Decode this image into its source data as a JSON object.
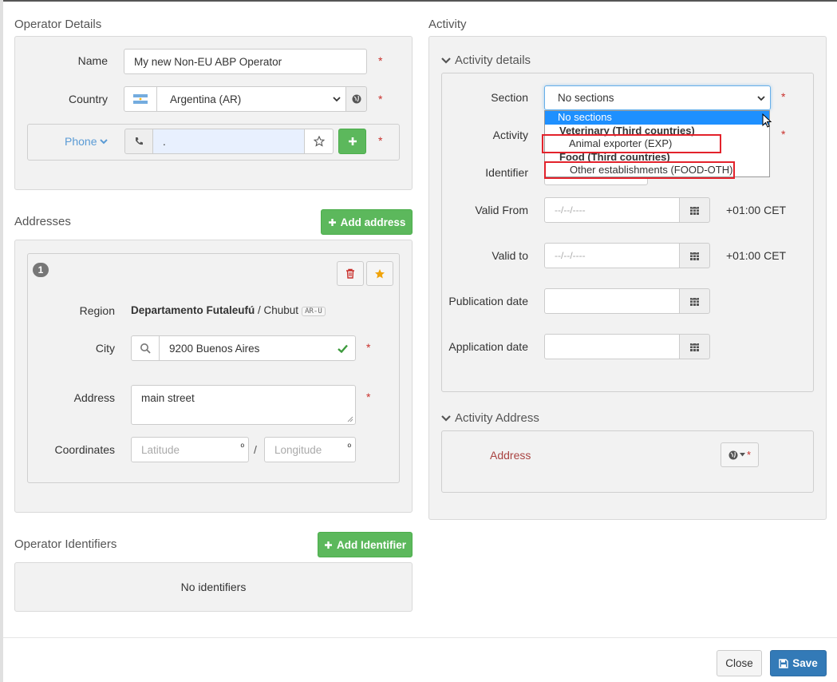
{
  "operator_details": {
    "title": "Operator Details",
    "name_label": "Name",
    "name_value": "My new Non-EU ABP Operator",
    "country_label": "Country",
    "country_value": "Argentina (AR)",
    "phone_label": "Phone",
    "phone_value": ".",
    "required_mark": "*"
  },
  "addresses": {
    "title": "Addresses",
    "add_button": "Add address",
    "index": "1",
    "region_label": "Region",
    "region_bold": "Departamento Futaleufú",
    "region_rest": " / Chubut",
    "region_code": "AR-U",
    "city_label": "City",
    "city_value": "9200 Buenos Aires",
    "address_label": "Address",
    "address_value": "main street",
    "coordinates_label": "Coordinates",
    "latitude_placeholder": "Latitude",
    "longitude_placeholder": "Longitude",
    "degree": "º",
    "separator": "/"
  },
  "operator_identifiers": {
    "title": "Operator Identifiers",
    "add_button": "Add Identifier",
    "empty_text": "No identifiers"
  },
  "activity": {
    "title": "Activity",
    "details_title": "Activity details",
    "section_label": "Section",
    "section_value": "No sections",
    "activity_label": "Activity",
    "identifier_label": "Identifier",
    "valid_from_label": "Valid From",
    "valid_to_label": "Valid to",
    "date_placeholder": "--/--/----",
    "timezone": "+01:00 CET",
    "publication_label": "Publication date",
    "application_label": "Application date",
    "address_section_title": "Activity Address",
    "address_label": "Address",
    "dropdown": {
      "options": [
        {
          "text": "No sections",
          "kind": "selected"
        },
        {
          "text": "Veterinary (Third countries)",
          "kind": "group"
        },
        {
          "text": "Animal exporter (EXP)",
          "kind": "option"
        },
        {
          "text": "Food (Third countries)",
          "kind": "group"
        },
        {
          "text": "Other establishments (FOOD-OTH)",
          "kind": "option"
        }
      ]
    }
  },
  "footer": {
    "close": "Close",
    "save": "Save"
  },
  "colors": {
    "required": "#c9302c",
    "green": "#5cb85c",
    "primary": "#337ab7",
    "highlight": "#1e90ff",
    "annotation_red": "#e3222b"
  }
}
